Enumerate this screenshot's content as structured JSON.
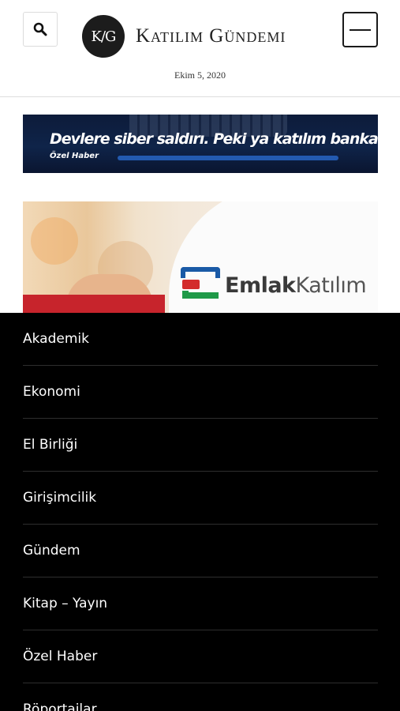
{
  "header": {
    "logo_badge": "K/G",
    "site_title": "Katılım Gündemi",
    "date": "Ekim 5, 2020",
    "search_icon": "search-icon",
    "menu_icon": "hamburger-icon"
  },
  "banner": {
    "title": "Devlere siber saldırı. Peki ya katılım bankaları?",
    "subtitle": "Özel Haber"
  },
  "article": {
    "brand_bold": "Emlak",
    "brand_light": "Katılım"
  },
  "nav": {
    "items": [
      {
        "label": "Akademik"
      },
      {
        "label": "Ekonomi"
      },
      {
        "label": "El Birliği"
      },
      {
        "label": "Girişimcilik"
      },
      {
        "label": "Gündem"
      },
      {
        "label": "Kitap – Yayın"
      },
      {
        "label": "Özel Haber"
      },
      {
        "label": "Röportajlar"
      }
    ]
  },
  "colors": {
    "overlay_bg": "#000000",
    "banner_bg": "#0f2449",
    "brand_blue": "#1a5aa6",
    "brand_red": "#d32c2c",
    "brand_green": "#1f9a48"
  }
}
